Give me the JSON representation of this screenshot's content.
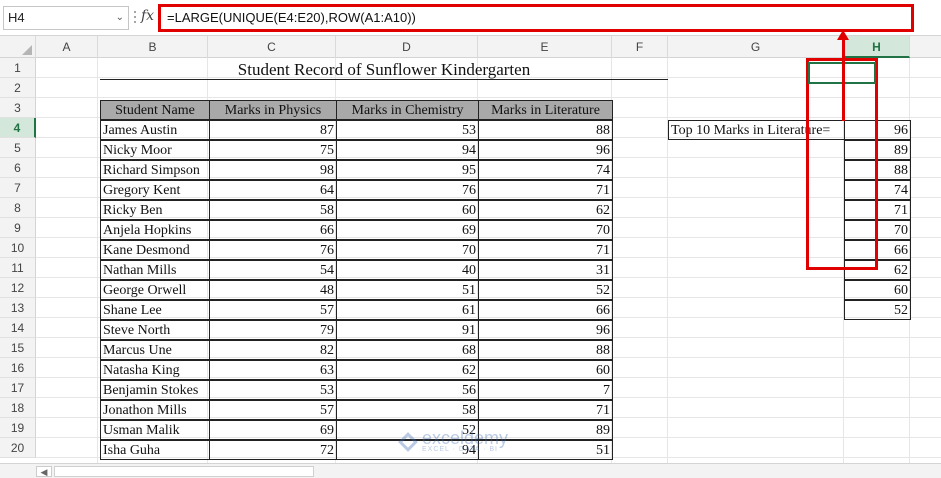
{
  "formula_bar": {
    "name_box": "H4",
    "fx_label": "fx",
    "formula": "=LARGE(UNIQUE(E4:E20),ROW(A1:A10))"
  },
  "columns": [
    "A",
    "B",
    "C",
    "D",
    "E",
    "F",
    "G",
    "H"
  ],
  "active_column": "H",
  "rows": [
    "1",
    "2",
    "3",
    "4",
    "5",
    "6",
    "7",
    "8",
    "9",
    "10",
    "11",
    "12",
    "13",
    "14",
    "15",
    "16",
    "17",
    "18",
    "19",
    "20"
  ],
  "active_row": "4",
  "sheet": {
    "title": "Student Record of Sunflower Kindergarten",
    "headers": [
      "Student Name",
      "Marks in Physics",
      "Marks in Chemistry",
      "Marks in Literature"
    ],
    "students": [
      [
        "James Austin",
        "87",
        "53",
        "88"
      ],
      [
        "Nicky Moor",
        "75",
        "94",
        "96"
      ],
      [
        "Richard Simpson",
        "98",
        "95",
        "74"
      ],
      [
        "Gregory Kent",
        "64",
        "76",
        "71"
      ],
      [
        "Ricky Ben",
        "58",
        "60",
        "62"
      ],
      [
        "Anjela Hopkins",
        "66",
        "69",
        "70"
      ],
      [
        "Kane Desmond",
        "76",
        "70",
        "71"
      ],
      [
        "Nathan Mills",
        "54",
        "40",
        "31"
      ],
      [
        "George Orwell",
        "48",
        "51",
        "52"
      ],
      [
        "Shane Lee",
        "57",
        "61",
        "66"
      ],
      [
        "Steve North",
        "79",
        "91",
        "96"
      ],
      [
        "Marcus Une",
        "82",
        "68",
        "88"
      ],
      [
        "Natasha King",
        "63",
        "62",
        "60"
      ],
      [
        "Benjamin Stokes",
        "53",
        "56",
        "7"
      ],
      [
        "Jonathon Mills",
        "57",
        "58",
        "71"
      ],
      [
        "Usman Malik",
        "69",
        "52",
        "89"
      ],
      [
        "Isha Guha",
        "72",
        "94",
        "51"
      ]
    ],
    "top_label": "Top 10 Marks in Literature=",
    "top_values": [
      "96",
      "89",
      "88",
      "74",
      "71",
      "70",
      "66",
      "62",
      "60",
      "52"
    ]
  },
  "watermark": {
    "main": "exceldemy",
    "sub": "EXCEL · DATA · BI"
  },
  "colors": {
    "highlight": "#e00000",
    "excel_green": "#217346",
    "header_fill": "#a9a9a9"
  },
  "icons": {
    "dropdown": "chevron-down-icon",
    "fx": "function-icon",
    "scroll_left": "chevron-left-icon"
  }
}
